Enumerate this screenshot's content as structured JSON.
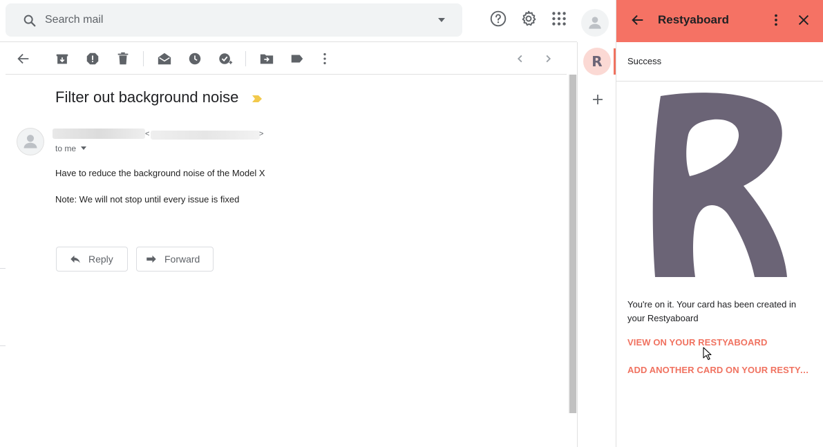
{
  "search": {
    "placeholder": "Search mail"
  },
  "toolbar": {
    "icons": [
      "back-icon",
      "archive-icon",
      "report-spam-icon",
      "delete-icon",
      "mark-unread-icon",
      "snooze-icon",
      "add-task-icon",
      "move-to-icon",
      "label-icon",
      "more-icon",
      "prev-icon",
      "next-icon"
    ]
  },
  "mail": {
    "subject": "Filter out background noise",
    "recipient_line": "to me",
    "lt": "<",
    "gt": ">",
    "body": [
      "Have to reduce the background noise of the Model X",
      "Note: We will not stop until every issue is fixed"
    ],
    "reply_label": "Reply",
    "forward_label": "Forward"
  },
  "rail": {
    "addon_letter": "R"
  },
  "addon": {
    "title": "Restyaboard",
    "status": "Success",
    "message": "You're on it. Your card has been created in your Restyaboard",
    "view_link": "VIEW ON YOUR RESTYABOARD",
    "add_link": "ADD ANOTHER CARD ON YOUR RESTYABOARD",
    "accent_color": "#f57264",
    "logo_color": "#6b6476"
  }
}
